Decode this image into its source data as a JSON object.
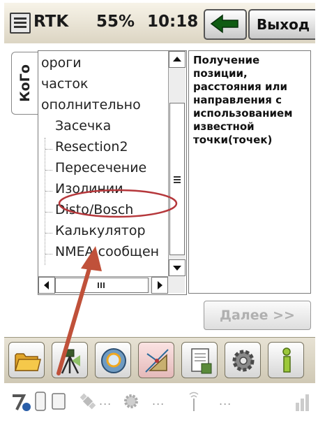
{
  "header": {
    "mode": "RTK",
    "battery": "55%",
    "time": "10:18",
    "exit_label": "Выход",
    "icons": [
      "menu-icon",
      "back-arrow-icon"
    ]
  },
  "side_tab": {
    "label": "КоГо"
  },
  "tree": {
    "items": [
      {
        "label": "ороги",
        "level": 0
      },
      {
        "label": "часток",
        "level": 0
      },
      {
        "label": "ополнительно",
        "level": 0
      },
      {
        "label": "Засечка",
        "level": 1
      },
      {
        "label": "Resection2",
        "level": 1
      },
      {
        "label": "Пересечение",
        "level": 1
      },
      {
        "label": "Изолинии",
        "level": 1
      },
      {
        "label": "Disto/Bosch",
        "level": 1,
        "highlighted": true
      },
      {
        "label": "Калькулятор",
        "level": 1
      },
      {
        "label": "NMEA сообщен",
        "level": 1
      }
    ],
    "scroll_icons": [
      "scroll-up-icon",
      "scroll-down-icon",
      "scroll-left-icon",
      "scroll-right-icon"
    ]
  },
  "description": {
    "text": "Получение позиции, расстояния или направления с использованием известной точки(точек)"
  },
  "footer": {
    "next_label": "Далее >>"
  },
  "toolbar": {
    "buttons": [
      "folder-icon",
      "survey-instrument-icon",
      "map-search-icon",
      "cogo-tools-icon",
      "document-icon",
      "settings-icon",
      "info-icon"
    ]
  },
  "colors": {
    "highlight_ellipse": "#b5373b",
    "arrow": "#c0513a",
    "scroll_panel": "#2f5f34",
    "next_disabled_text": "#b0b0b0"
  }
}
